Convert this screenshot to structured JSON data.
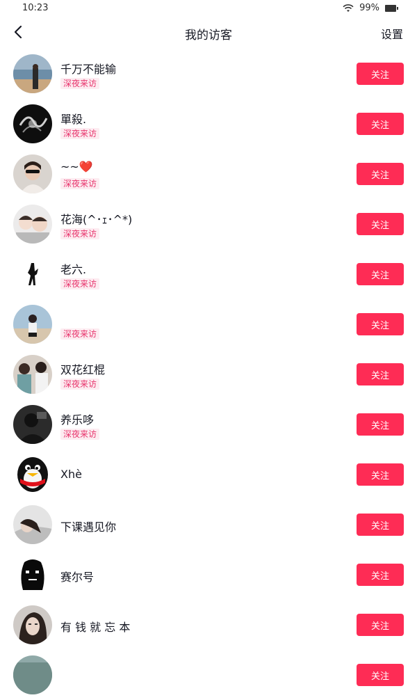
{
  "status_bar": {
    "time": "10:23",
    "battery": "99%"
  },
  "header": {
    "title": "我的访客",
    "settings_label": "设置"
  },
  "follow_label": "关注",
  "tag_label": "深夜来访",
  "visitors": [
    {
      "name": "千万不能输",
      "tag": true,
      "avatar": "beach-photo"
    },
    {
      "name": "單殺.",
      "tag": true,
      "avatar": "dark-smoke"
    },
    {
      "name": "~~❤️",
      "tag": true,
      "avatar": "girl-sunglasses"
    },
    {
      "name": "花海(^･ｪ･^*)",
      "tag": true,
      "avatar": "two-kids"
    },
    {
      "name": "老六.",
      "tag": true,
      "avatar": "polo-logo"
    },
    {
      "name": "",
      "tag": true,
      "avatar": "girl-beach"
    },
    {
      "name": "双花红棍",
      "tag": true,
      "avatar": "two-people"
    },
    {
      "name": "养乐哆",
      "tag": true,
      "avatar": "dark-figure"
    },
    {
      "name": "Xhè",
      "tag": false,
      "avatar": "qq-penguin"
    },
    {
      "name": "下课遇见你",
      "tag": false,
      "avatar": "lying-girl"
    },
    {
      "name": "赛尔号",
      "tag": false,
      "avatar": "black-blob"
    },
    {
      "name": "有 钱 就 忘 本",
      "tag": false,
      "avatar": "girl-portrait"
    },
    {
      "name": "",
      "tag": false,
      "avatar": "partial-photo"
    }
  ]
}
